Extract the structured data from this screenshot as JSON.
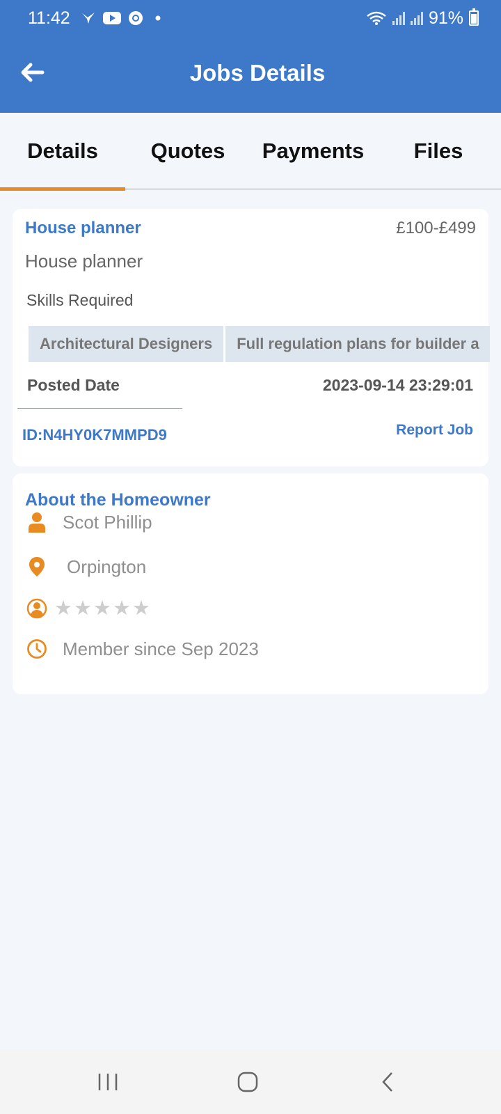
{
  "status_bar": {
    "time": "11:42",
    "battery": "91%"
  },
  "header": {
    "title": "Jobs Details"
  },
  "tabs": [
    {
      "label": "Details",
      "active": true
    },
    {
      "label": "Quotes",
      "active": false
    },
    {
      "label": "Payments",
      "active": false
    },
    {
      "label": "Files",
      "active": false
    }
  ],
  "job": {
    "title": "House planner",
    "budget": "£100-£499",
    "description": "House planner",
    "skills_label": "Skills Required",
    "skills": [
      "Architectural Designers",
      "Full regulation plans for builder a"
    ],
    "posted_label": "Posted Date",
    "posted_value": "2023-09-14 23:29:01",
    "id": "ID:N4HY0K7MMPD9",
    "report_label": "Report Job"
  },
  "homeowner": {
    "section_title": "About the Homeowner",
    "name": "Scot Phillip",
    "location": "Orpington",
    "rating": 0,
    "rating_max": 5,
    "member_since": "Member since Sep 2023"
  },
  "colors": {
    "primary": "#3d78c9",
    "accent": "#e88b22",
    "star_empty": "#cdcdcd"
  },
  "icons": {
    "back": "arrow-left-icon",
    "name": "person-icon",
    "location": "location-pin-icon",
    "rating": "user-circle-icon",
    "member": "clock-icon"
  }
}
